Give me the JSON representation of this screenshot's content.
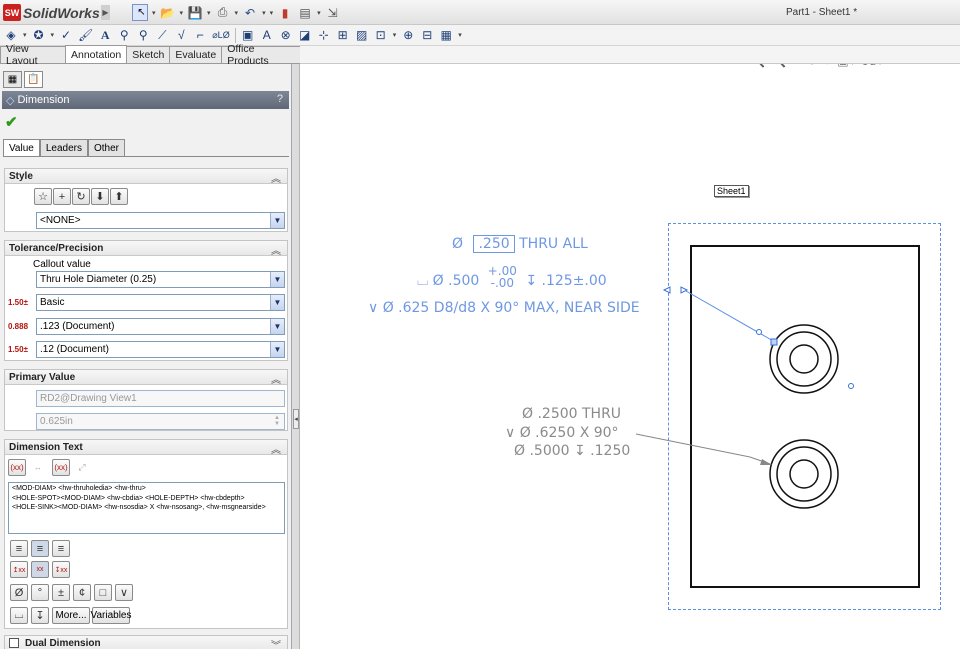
{
  "app": {
    "name": "SolidWorks",
    "logo_mark": "SW",
    "document_title": "Part1 - Sheet1 *"
  },
  "command_tabs": [
    {
      "label": "View Layout",
      "active": false
    },
    {
      "label": "Annotation",
      "active": true
    },
    {
      "label": "Sketch",
      "active": false
    },
    {
      "label": "Evaluate",
      "active": false
    },
    {
      "label": "Office Products",
      "active": false
    }
  ],
  "property_manager": {
    "title": "Dimension",
    "help": "?",
    "value_tabs": [
      {
        "label": "Value",
        "active": true
      },
      {
        "label": "Leaders",
        "active": false
      },
      {
        "label": "Other",
        "active": false
      }
    ],
    "style": {
      "title": "Style",
      "selected": "<NONE>"
    },
    "tolerance": {
      "title": "Tolerance/Precision",
      "callout_label": "Callout value",
      "callout_value": "Thru Hole Diameter (0.25)",
      "tolerance_type": "Basic",
      "primary_precision": ".123 (Document)",
      "tolerance_precision": ".12 (Document)"
    },
    "primary_value": {
      "title": "Primary Value",
      "name": "RD2@Drawing View1",
      "value": "0.625in"
    },
    "dimension_text": {
      "title": "Dimension Text",
      "lines": [
        "<MOD-DIAM> <hw-thruholedia> <hw-thru>",
        "<HOLE-SPOT><MOD-DIAM> <hw-cbdia> <HOLE-DEPTH> <hw-cbdepth>",
        "<HOLE-SINK><MOD-DIAM> <hw-nsosdia> X <hw-nsosang>, <hw-msgnearside>"
      ],
      "symbol_buttons": [
        "Ø",
        "°",
        "±",
        "¢",
        "□",
        "∨"
      ],
      "more_label": "More...",
      "variables_label": "Variables"
    },
    "dual_dimension": {
      "title": "Dual Dimension"
    }
  },
  "drawing": {
    "sheet_label": "Sheet1",
    "blue_callout": {
      "line1_diam": "Ø",
      "line1_value": ".250",
      "line1_suffix": "THRU ALL",
      "line2_prefix": "⌴  Ø  .500",
      "line2_tol_upper": "+.00",
      "line2_tol_lower": "-.00",
      "line2_suffix": "↧ .125±.00",
      "line3": "∨  Ø .625 D8/d8 X 90° MAX, NEAR SIDE"
    },
    "gray_callout": {
      "line1": "Ø .2500 THRU",
      "line2": "∨  Ø .6250 X 90°",
      "line3": "Ø .5000 ↧ .1250"
    }
  },
  "colors": {
    "annotation_blue": "#6f98e2",
    "annotation_gray": "#8a8a8a",
    "pm_header": "#6b7482",
    "view_border": "#5b8ee6"
  }
}
